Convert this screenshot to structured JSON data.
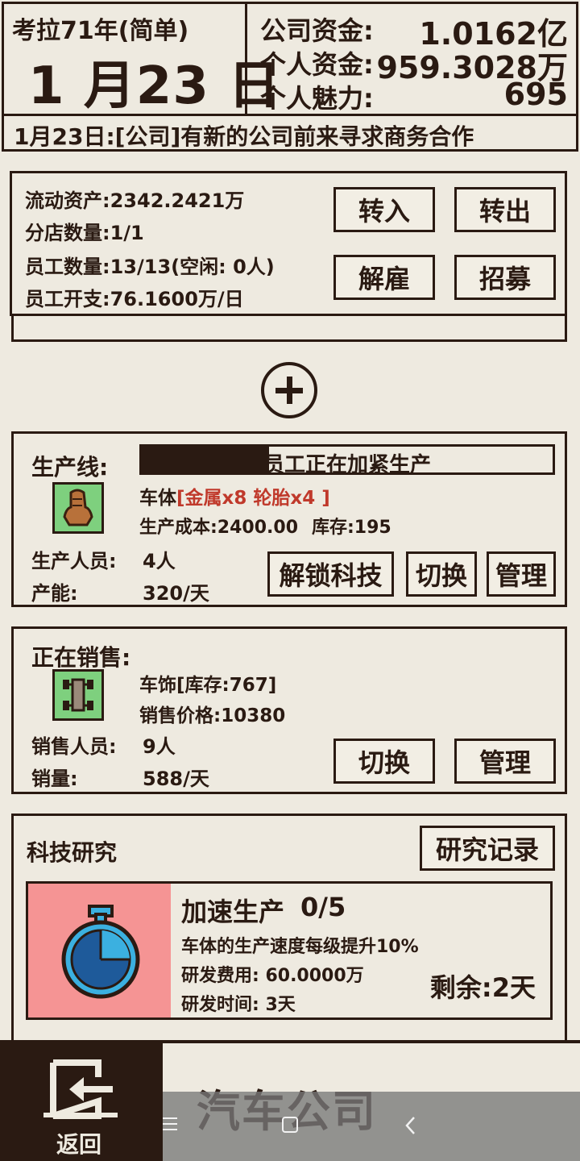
{
  "header": {
    "era": "考拉71年(简单)",
    "date": "1 月23 日",
    "company_funds_label": "公司资金:",
    "company_funds_value": "1.0162亿",
    "personal_funds_label": "个人资金:",
    "personal_funds_value": "959.3028万",
    "charm_label": "个人魅力:",
    "charm_value": "695"
  },
  "news": "1月23日:[公司]有新的公司前来寻求商务合作",
  "assets": {
    "liquid": "流动资产:2342.2421万",
    "branches": "分店数量:1/1",
    "employees": "员工数量:13/13(空闲: 0人)",
    "expense": "员工开支:76.1600万/日",
    "transfer_in": "转入",
    "transfer_out": "转出",
    "fire": "解雇",
    "recruit": "招募"
  },
  "production": {
    "title": "生产线:",
    "status": "员工正在加紧生产",
    "product": "车体",
    "materials": "[金属x8 轮胎x4 ]",
    "cost": "生产成本:2400.00",
    "stock": "库存:195",
    "staff_label": "生产人员:",
    "staff_value": "4人",
    "capacity_label": "产能:",
    "capacity_value": "320/天",
    "unlock_tech": "解锁科技",
    "switch": "切换",
    "manage": "管理"
  },
  "sales": {
    "title": "正在销售:",
    "product": "车饰[库存:767]",
    "price": "销售价格:10380",
    "staff_label": "销售人员:",
    "staff_value": "9人",
    "volume_label": "销量:",
    "volume_value": "588/天",
    "switch": "切换",
    "manage": "管理"
  },
  "research": {
    "title": "科技研究",
    "records_button": "研究记录",
    "item_name": "加速生产",
    "item_level": "0/5",
    "item_desc": "车体的生产速度每级提升10%",
    "item_cost": "研发费用: 60.0000万",
    "item_time": "研发时间: 3天",
    "remaining": "剩余:2天"
  },
  "bottom": {
    "back_label": "返回",
    "company_name": "汽车公司"
  },
  "colors": {
    "background": "#eeeae0",
    "ink": "#2a1a12",
    "material_red": "#c0392b",
    "research_card": "#f59494",
    "icon_green": "#7ed07e",
    "stopwatch_blue": "#3bb0e0"
  }
}
